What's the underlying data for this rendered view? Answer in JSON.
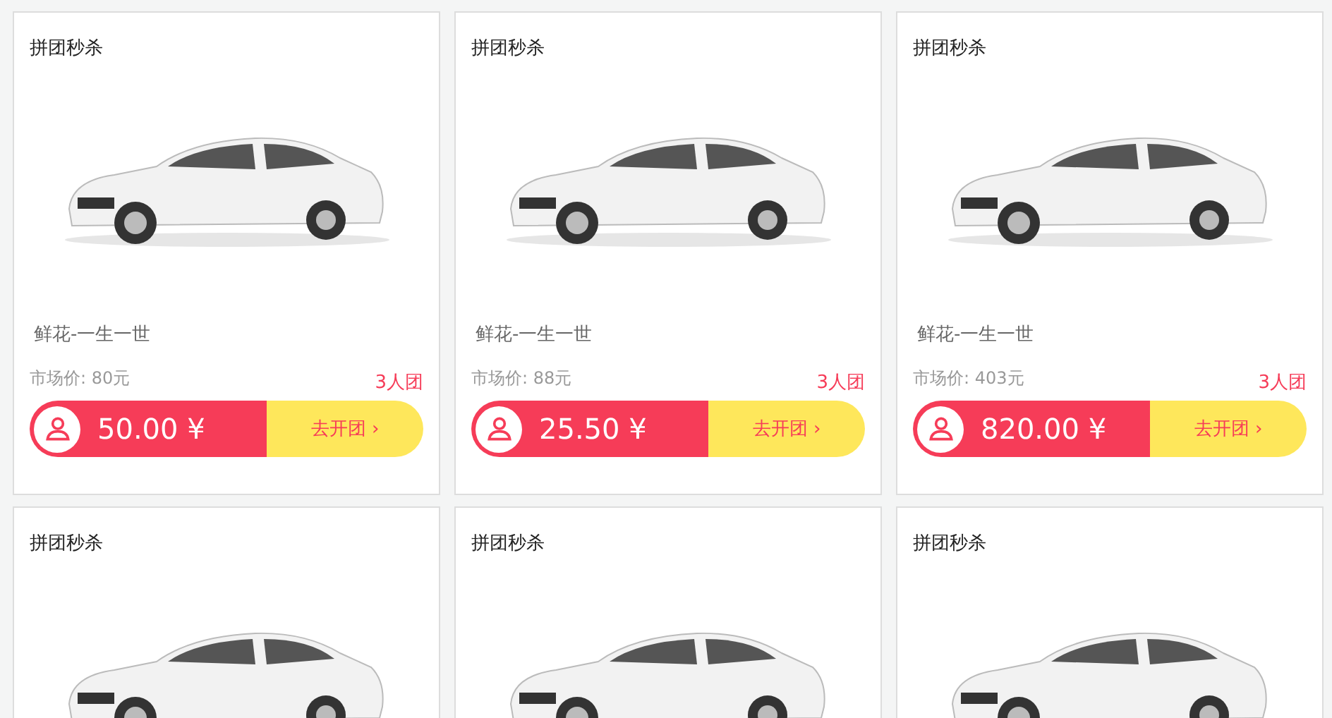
{
  "products": [
    {
      "title": "拼团秒杀",
      "name": "鲜花-一生一世",
      "market_price": "市场价: 80元",
      "group_size": "3人团",
      "price": "50.00 ¥",
      "action": "去开团",
      "chevron": "›"
    },
    {
      "title": "拼团秒杀",
      "name": "鲜花-一生一世",
      "market_price": "市场价: 88元",
      "group_size": "3人团",
      "price": "25.50 ¥",
      "action": "去开团",
      "chevron": "›"
    },
    {
      "title": "拼团秒杀",
      "name": "鲜花-一生一世",
      "market_price": "市场价: 403元",
      "group_size": "3人团",
      "price": "820.00 ¥",
      "action": "去开团",
      "chevron": "›"
    },
    {
      "title": "拼团秒杀"
    },
    {
      "title": "拼团秒杀"
    },
    {
      "title": "拼团秒杀"
    }
  ]
}
